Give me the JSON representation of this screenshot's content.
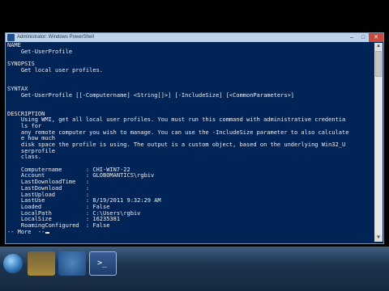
{
  "window": {
    "title": "Administrator: Windows PowerShell",
    "buttons": {
      "minimize": "–",
      "maximize": "□",
      "close": "✕"
    }
  },
  "console": {
    "lines": [
      "NAME",
      "    Get-UserProfile",
      "",
      "SYNOPSIS",
      "    Get local user profiles.",
      "",
      "",
      "SYNTAX",
      "    Get-UserProfile [[-Computername] <String[]>] [-IncludeSize] [<CommonParameters>]",
      "",
      "",
      "DESCRIPTION",
      "    Using WMI, get all local user profiles. You must run this command with administrative credentia",
      "    ls for",
      "    any remote computer you wish to manage. You can use the -IncludeSize parameter to also calculate",
      "    e how much",
      "    disk space the profile is using. The output is a custom object, based on the underlying Win32_U",
      "    serprofile",
      "    class.",
      "",
      "    Computername       : CHI-WIN7-22",
      "    Account            : GLOBOMANTICS\\rgbiv",
      "    LastDownloadTime   :",
      "    LastDownload       :",
      "    LastUpload         :",
      "    LastUse            : 8/19/2011 9:32:29 AM",
      "    Loaded             : False",
      "    LocalPath          : C:\\Users\\rgbiv",
      "    LocalSize          : 16235381",
      "    RoamingConfigured  : False"
    ],
    "more_prompt": "-- More  --"
  },
  "scrollbar": {
    "up": "▲",
    "down": "▼"
  },
  "taskbar": {
    "powershell_glyph": ">_"
  },
  "colors": {
    "console_bg": "#012456",
    "console_fg": "#eeedf0"
  }
}
